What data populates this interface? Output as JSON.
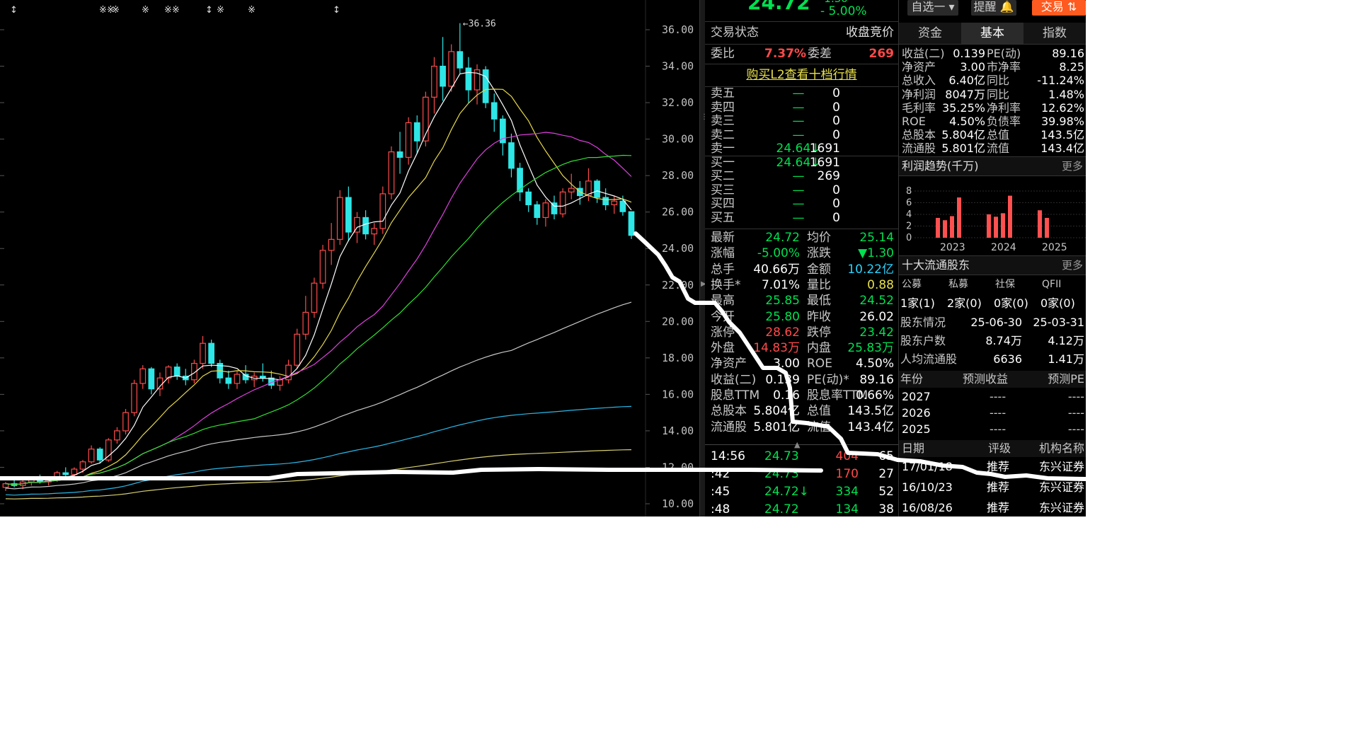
{
  "top_price": {
    "price": "24.72",
    "change_top": "-1.30",
    "change_pct": "- 5.00%"
  },
  "toolbar": {
    "watchlist": "自选一",
    "alert": "提醒",
    "trade": "交易"
  },
  "chart_data": {
    "type": "candlestick",
    "y_ticks": [
      "36.00",
      "34.00",
      "32.00",
      "30.00",
      "28.00",
      "26.00",
      "24.00",
      "22.00",
      "20.00",
      "18.00",
      "16.00",
      "14.00",
      "12.00",
      "10.00"
    ],
    "ylim": [
      10,
      36
    ],
    "high_marker": "36.36",
    "event_markers": [
      "↕",
      "※※",
      "※",
      "※",
      "※※",
      "↕",
      "※",
      "※",
      "↕"
    ],
    "colors": {
      "up": "#ff4a4a",
      "down": "#2ee6e6",
      "ma5": "#ffffff",
      "ma10": "#e6d84a",
      "ma20": "#e040e0",
      "ma30": "#30e030",
      "ma60": "#c8c8c8",
      "ma120": "#2ab8e8",
      "ma250": "#d8d070"
    },
    "candles": [
      {
        "o": 10.9,
        "h": 11.2,
        "l": 10.7,
        "c": 11.1
      },
      {
        "o": 11.1,
        "h": 11.4,
        "l": 10.9,
        "c": 11.0
      },
      {
        "o": 11.0,
        "h": 11.3,
        "l": 10.8,
        "c": 11.2
      },
      {
        "o": 11.2,
        "h": 11.5,
        "l": 11.0,
        "c": 11.4
      },
      {
        "o": 11.4,
        "h": 11.6,
        "l": 11.1,
        "c": 11.2
      },
      {
        "o": 11.2,
        "h": 11.5,
        "l": 11.0,
        "c": 11.4
      },
      {
        "o": 11.4,
        "h": 11.8,
        "l": 11.2,
        "c": 11.7
      },
      {
        "o": 11.7,
        "h": 12.0,
        "l": 11.5,
        "c": 11.6
      },
      {
        "o": 11.6,
        "h": 12.0,
        "l": 11.4,
        "c": 11.9
      },
      {
        "o": 11.9,
        "h": 12.4,
        "l": 11.7,
        "c": 12.3
      },
      {
        "o": 12.3,
        "h": 13.2,
        "l": 12.2,
        "c": 13.0
      },
      {
        "o": 13.0,
        "h": 13.1,
        "l": 12.2,
        "c": 12.4
      },
      {
        "o": 12.4,
        "h": 13.6,
        "l": 12.3,
        "c": 13.5
      },
      {
        "o": 13.5,
        "h": 14.2,
        "l": 13.3,
        "c": 14.0
      },
      {
        "o": 14.0,
        "h": 15.2,
        "l": 13.8,
        "c": 15.0
      },
      {
        "o": 15.0,
        "h": 16.8,
        "l": 14.8,
        "c": 16.6
      },
      {
        "o": 16.6,
        "h": 17.6,
        "l": 16.3,
        "c": 17.4
      },
      {
        "o": 17.4,
        "h": 17.5,
        "l": 16.0,
        "c": 16.3
      },
      {
        "o": 16.3,
        "h": 17.2,
        "l": 15.9,
        "c": 16.9
      },
      {
        "o": 16.9,
        "h": 17.6,
        "l": 16.6,
        "c": 17.5
      },
      {
        "o": 17.5,
        "h": 17.7,
        "l": 16.8,
        "c": 17.0
      },
      {
        "o": 17.0,
        "h": 17.4,
        "l": 16.5,
        "c": 16.8
      },
      {
        "o": 16.8,
        "h": 17.9,
        "l": 16.6,
        "c": 17.7
      },
      {
        "o": 17.7,
        "h": 19.2,
        "l": 17.4,
        "c": 18.8
      },
      {
        "o": 18.8,
        "h": 19.0,
        "l": 17.5,
        "c": 17.7
      },
      {
        "o": 17.7,
        "h": 17.9,
        "l": 16.6,
        "c": 16.9
      },
      {
        "o": 16.9,
        "h": 17.3,
        "l": 16.3,
        "c": 16.6
      },
      {
        "o": 16.6,
        "h": 17.3,
        "l": 16.3,
        "c": 17.1
      },
      {
        "o": 17.1,
        "h": 17.6,
        "l": 16.6,
        "c": 16.8
      },
      {
        "o": 16.8,
        "h": 17.2,
        "l": 16.4,
        "c": 17.0
      },
      {
        "o": 17.0,
        "h": 17.7,
        "l": 16.7,
        "c": 16.9
      },
      {
        "o": 16.9,
        "h": 17.3,
        "l": 16.3,
        "c": 16.5
      },
      {
        "o": 16.5,
        "h": 17.0,
        "l": 16.2,
        "c": 16.8
      },
      {
        "o": 16.8,
        "h": 17.9,
        "l": 16.6,
        "c": 17.6
      },
      {
        "o": 17.6,
        "h": 19.6,
        "l": 17.4,
        "c": 19.3
      },
      {
        "o": 19.3,
        "h": 21.4,
        "l": 19.0,
        "c": 20.5
      },
      {
        "o": 20.5,
        "h": 22.4,
        "l": 20.2,
        "c": 22.1
      },
      {
        "o": 22.1,
        "h": 24.2,
        "l": 21.8,
        "c": 23.9
      },
      {
        "o": 23.9,
        "h": 25.4,
        "l": 23.1,
        "c": 24.5
      },
      {
        "o": 24.5,
        "h": 27.2,
        "l": 24.2,
        "c": 26.8
      },
      {
        "o": 26.8,
        "h": 27.4,
        "l": 24.4,
        "c": 24.9
      },
      {
        "o": 24.9,
        "h": 26.0,
        "l": 24.3,
        "c": 25.7
      },
      {
        "o": 25.7,
        "h": 26.1,
        "l": 24.5,
        "c": 24.8
      },
      {
        "o": 24.8,
        "h": 25.4,
        "l": 24.2,
        "c": 25.1
      },
      {
        "o": 25.1,
        "h": 27.4,
        "l": 24.8,
        "c": 27.0
      },
      {
        "o": 27.0,
        "h": 29.6,
        "l": 26.7,
        "c": 29.3
      },
      {
        "o": 29.3,
        "h": 30.4,
        "l": 28.1,
        "c": 29.0
      },
      {
        "o": 29.0,
        "h": 31.2,
        "l": 28.6,
        "c": 30.9
      },
      {
        "o": 30.9,
        "h": 31.3,
        "l": 29.2,
        "c": 29.9
      },
      {
        "o": 29.9,
        "h": 32.6,
        "l": 29.6,
        "c": 32.3
      },
      {
        "o": 32.3,
        "h": 34.5,
        "l": 31.4,
        "c": 34.0
      },
      {
        "o": 34.0,
        "h": 35.6,
        "l": 32.1,
        "c": 32.9
      },
      {
        "o": 32.9,
        "h": 35.2,
        "l": 32.6,
        "c": 34.8
      },
      {
        "o": 34.8,
        "h": 36.36,
        "l": 33.6,
        "c": 33.9
      },
      {
        "o": 33.9,
        "h": 34.5,
        "l": 32.0,
        "c": 32.7
      },
      {
        "o": 32.7,
        "h": 34.1,
        "l": 31.9,
        "c": 33.8
      },
      {
        "o": 33.8,
        "h": 34.0,
        "l": 31.7,
        "c": 32.0
      },
      {
        "o": 32.0,
        "h": 32.5,
        "l": 30.4,
        "c": 31.1
      },
      {
        "o": 31.1,
        "h": 31.3,
        "l": 29.1,
        "c": 29.8
      },
      {
        "o": 29.8,
        "h": 30.3,
        "l": 27.9,
        "c": 28.4
      },
      {
        "o": 28.4,
        "h": 28.7,
        "l": 26.6,
        "c": 27.1
      },
      {
        "o": 27.1,
        "h": 27.3,
        "l": 26.0,
        "c": 26.4
      },
      {
        "o": 26.4,
        "h": 26.6,
        "l": 25.3,
        "c": 25.7
      },
      {
        "o": 25.7,
        "h": 26.7,
        "l": 25.2,
        "c": 26.5
      },
      {
        "o": 26.5,
        "h": 26.9,
        "l": 25.6,
        "c": 25.9
      },
      {
        "o": 25.9,
        "h": 27.3,
        "l": 25.7,
        "c": 27.1
      },
      {
        "o": 27.1,
        "h": 28.1,
        "l": 26.7,
        "c": 27.3
      },
      {
        "o": 27.3,
        "h": 27.7,
        "l": 26.4,
        "c": 26.9
      },
      {
        "o": 26.9,
        "h": 28.4,
        "l": 26.6,
        "c": 27.7
      },
      {
        "o": 27.7,
        "h": 27.8,
        "l": 26.5,
        "c": 26.8
      },
      {
        "o": 26.8,
        "h": 27.3,
        "l": 26.1,
        "c": 26.4
      },
      {
        "o": 26.4,
        "h": 26.9,
        "l": 25.9,
        "c": 26.6
      },
      {
        "o": 26.6,
        "h": 26.9,
        "l": 25.8,
        "c": 26.02
      },
      {
        "o": 26.02,
        "h": 25.85,
        "l": 24.52,
        "c": 24.72
      }
    ]
  },
  "quote": {
    "status_label": "交易状态",
    "status_value": "收盘竞价",
    "weibi_label": "委比",
    "weibi_value": "7.37%",
    "weicha_label": "委差",
    "weicha_value": "269",
    "l2_link": "购买L2查看十档行情",
    "book": [
      {
        "label": "卖五",
        "price": "—",
        "vol": "0",
        "cls": "green"
      },
      {
        "label": "卖四",
        "price": "—",
        "vol": "0",
        "cls": "green"
      },
      {
        "label": "卖三",
        "price": "—",
        "vol": "0",
        "cls": "green"
      },
      {
        "label": "卖二",
        "price": "—",
        "vol": "0",
        "cls": "green"
      },
      {
        "label": "卖一",
        "price": "24.64",
        "arrow": "↓",
        "vol": "1691",
        "cls": "green"
      },
      {
        "label": "买一",
        "price": "24.64",
        "arrow": "↓",
        "vol": "1691",
        "cls": "green"
      },
      {
        "label": "买二",
        "price": "—",
        "vol": "269",
        "cls": "green"
      },
      {
        "label": "买三",
        "price": "—",
        "vol": "0",
        "cls": "green"
      },
      {
        "label": "买四",
        "price": "—",
        "vol": "0",
        "cls": "green"
      },
      {
        "label": "买五",
        "price": "—",
        "vol": "0",
        "cls": "green"
      }
    ],
    "stats": [
      {
        "l1": "最新",
        "v1": "24.72",
        "c1": "green",
        "l2": "均价",
        "v2": "25.14",
        "c2": "green"
      },
      {
        "l1": "涨幅",
        "v1": "-5.00%",
        "c1": "green",
        "l2": "涨跌",
        "v2": "▼1.30",
        "c2": "green"
      },
      {
        "l1": "总手",
        "v1": "40.66万",
        "c1": "white",
        "l2": "金额",
        "v2": "10.22亿",
        "c2": "cyan"
      },
      {
        "l1": "换手*",
        "v1": "7.01%",
        "c1": "white",
        "l2": "量比",
        "v2": "0.88",
        "c2": "yellow"
      },
      {
        "l1": "最高",
        "v1": "25.85",
        "c1": "green",
        "l2": "最低",
        "v2": "24.52",
        "c2": "green"
      },
      {
        "l1": "今开",
        "v1": "25.80",
        "c1": "green",
        "l2": "昨收",
        "v2": "26.02",
        "c2": "white"
      },
      {
        "l1": "涨停",
        "v1": "28.62",
        "c1": "red",
        "l2": "跌停",
        "v2": "23.42",
        "c2": "green"
      },
      {
        "l1": "外盘",
        "v1": "14.83万",
        "c1": "red",
        "l2": "内盘",
        "v2": "25.83万",
        "c2": "green"
      },
      {
        "l1": "净资产",
        "v1": "3.00",
        "c1": "white",
        "l2": "ROE",
        "v2": "4.50%",
        "c2": "white"
      },
      {
        "l1": "收益(二)",
        "v1": "0.139",
        "c1": "white",
        "l2": "PE(动)*",
        "v2": "89.16",
        "c2": "white"
      },
      {
        "l1": "股息TTM",
        "v1": "0.16",
        "c1": "white",
        "l2": "股息率TTM",
        "v2": "0.66%",
        "c2": "white"
      },
      {
        "l1": "总股本",
        "v1": "5.804亿",
        "c1": "white",
        "l2": "总值",
        "v2": "143.5亿",
        "c2": "white"
      },
      {
        "l1": "流通股",
        "v1": "5.801亿",
        "c1": "white",
        "l2": "流值",
        "v2": "143.4亿",
        "c2": "white"
      }
    ],
    "ticks": [
      {
        "time": "14:56",
        "price": "24.73",
        "vol": "404",
        "n": "65",
        "vcls": "red"
      },
      {
        "time": ":42",
        "price": "24.73",
        "vol": "170",
        "n": "27",
        "vcls": "red"
      },
      {
        "time": ":45",
        "price": "24.72↓",
        "vol": "334",
        "n": "52",
        "vcls": "green"
      },
      {
        "time": ":48",
        "price": "24.72",
        "vol": "134",
        "n": "38",
        "vcls": "green"
      }
    ]
  },
  "fund": {
    "tabs": [
      "资金",
      "基本",
      "指数"
    ],
    "rows": [
      {
        "l1": "收益(二)",
        "v1": "0.139",
        "l2": "PE(动)",
        "v2": "89.16"
      },
      {
        "l1": "净资产",
        "v1": "3.00",
        "l2": "市净率",
        "v2": "8.25"
      },
      {
        "l1": "总收入",
        "v1": "6.40亿",
        "l2": "同比",
        "v2": "-11.24%"
      },
      {
        "l1": "净利润",
        "v1": "8047万",
        "l2": "同比",
        "v2": "1.48%"
      },
      {
        "l1": "毛利率",
        "v1": "35.25%",
        "l2": "净利率",
        "v2": "12.62%"
      },
      {
        "l1": "ROE",
        "v1": "4.50%",
        "l2": "负债率",
        "v2": "39.98%"
      },
      {
        "l1": "总股本",
        "v1": "5.804亿",
        "l2": "总值",
        "v2": "143.5亿"
      },
      {
        "l1": "流通股",
        "v1": "5.801亿",
        "l2": "流值",
        "v2": "143.4亿"
      }
    ],
    "profit_title": "利润趋势(千万)",
    "more": "更多",
    "profit_chart": {
      "y_ticks": [
        "8",
        "6",
        "4",
        "2",
        "0"
      ],
      "ylim": [
        0,
        8
      ],
      "years": [
        "2023",
        "2024",
        "2025"
      ],
      "bars": [
        3.4,
        3.0,
        3.7,
        6.9,
        4.0,
        3.6,
        4.2,
        7.2,
        4.7,
        3.4
      ],
      "bar_color": "#ff5050"
    },
    "holders_title": "十大流通股东",
    "holder_types": [
      "公募",
      "私募",
      "社保",
      "QFII"
    ],
    "holder_counts": [
      "1家(1)",
      "2家(0)",
      "0家(0)",
      "0家(0)"
    ],
    "holder_rows": [
      {
        "l": "股东情况",
        "a": "25-06-30",
        "b": "25-03-31"
      },
      {
        "l": "股东户数",
        "a": "8.74万",
        "b": "4.12万"
      },
      {
        "l": "人均流通股",
        "a": "6636",
        "b": "1.41万"
      }
    ],
    "forecast_header": [
      "年份",
      "预测收益",
      "预测PE"
    ],
    "forecast_rows": [
      {
        "y": "2027",
        "a": "----",
        "b": "----"
      },
      {
        "y": "2026",
        "a": "----",
        "b": "----"
      },
      {
        "y": "2025",
        "a": "----",
        "b": "----"
      }
    ],
    "rating_header": [
      "日期",
      "评级",
      "机构名称"
    ],
    "rating_rows": [
      {
        "d": "17/01/18",
        "r": "推荐",
        "o": "东兴证券"
      },
      {
        "d": "16/10/23",
        "r": "推荐",
        "o": "东兴证券"
      },
      {
        "d": "16/08/26",
        "r": "推荐",
        "o": "东兴证券"
      }
    ]
  }
}
